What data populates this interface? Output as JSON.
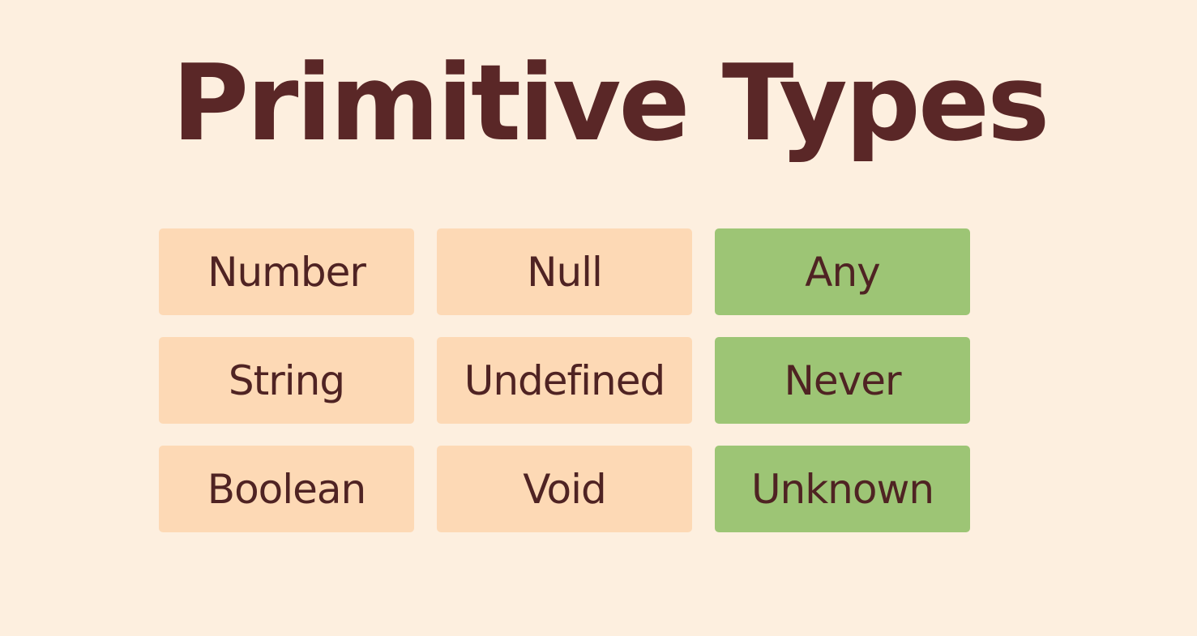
{
  "title": "Primitive Types",
  "colors": {
    "background": "#fdefdf",
    "title_text": "#5a2727",
    "primitive_box": "#fdd9b5",
    "special_box": "#9dc575"
  },
  "columns": [
    {
      "style": "primitive",
      "items": [
        "Number",
        "String",
        "Boolean"
      ]
    },
    {
      "style": "primitive",
      "items": [
        "Null",
        "Undefined",
        "Void"
      ]
    },
    {
      "style": "special",
      "items": [
        "Any",
        "Never",
        "Unknown"
      ]
    }
  ]
}
